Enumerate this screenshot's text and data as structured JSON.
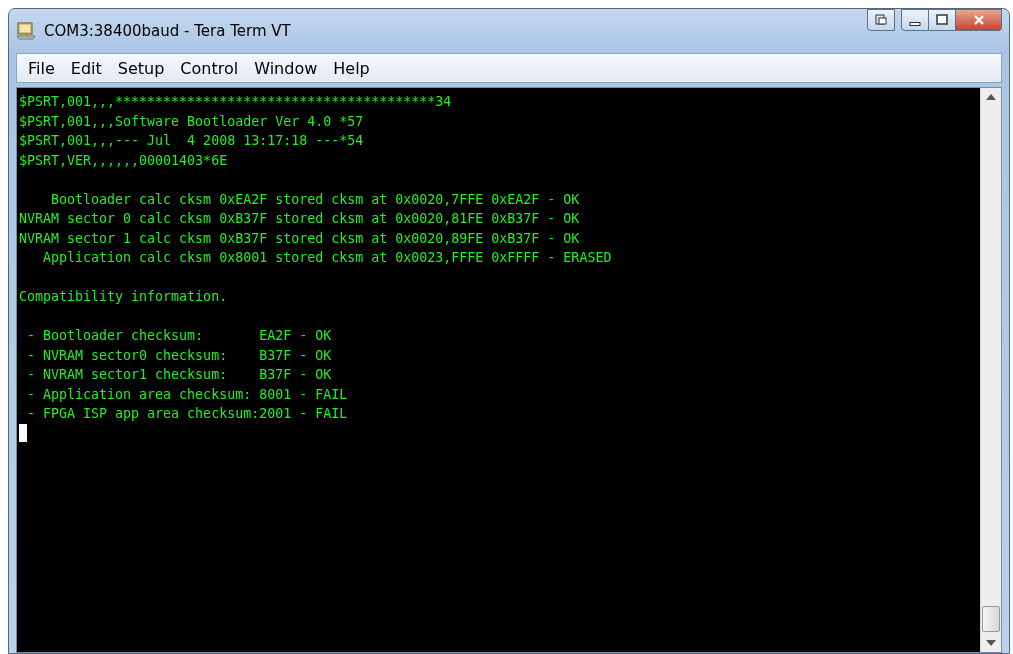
{
  "window": {
    "title": "COM3:38400baud - Tera Term VT"
  },
  "menu": [
    "File",
    "Edit",
    "Setup",
    "Control",
    "Window",
    "Help"
  ],
  "terminal": {
    "blocks": [
      [
        "$PSRT,001,,,****************************************34",
        "$PSRT,001,,,Software Bootloader Ver 4.0 *57",
        "$PSRT,001,,,--- Jul  4 2008 13:17:18 ---*54",
        "$PSRT,VER,,,,,,00001403*6E"
      ],
      [
        "    Bootloader calc cksm 0xEA2F stored cksm at 0x0020,7FFE 0xEA2F - OK",
        "NVRAM sector 0 calc cksm 0xB37F stored cksm at 0x0020,81FE 0xB37F - OK",
        "NVRAM sector 1 calc cksm 0xB37F stored cksm at 0x0020,89FE 0xB37F - OK",
        "   Application calc cksm 0x8001 stored cksm at 0x0023,FFFE 0xFFFF - ERASED"
      ],
      [
        "Compatibility information."
      ],
      [
        " - Bootloader checksum:       EA2F - OK",
        " - NVRAM sector0 checksum:    B37F - OK",
        " - NVRAM sector1 checksum:    B37F - OK",
        " - Application area checksum: 8001 - FAIL",
        " - FPGA ISP app area checksum:2001 - FAIL"
      ]
    ]
  }
}
